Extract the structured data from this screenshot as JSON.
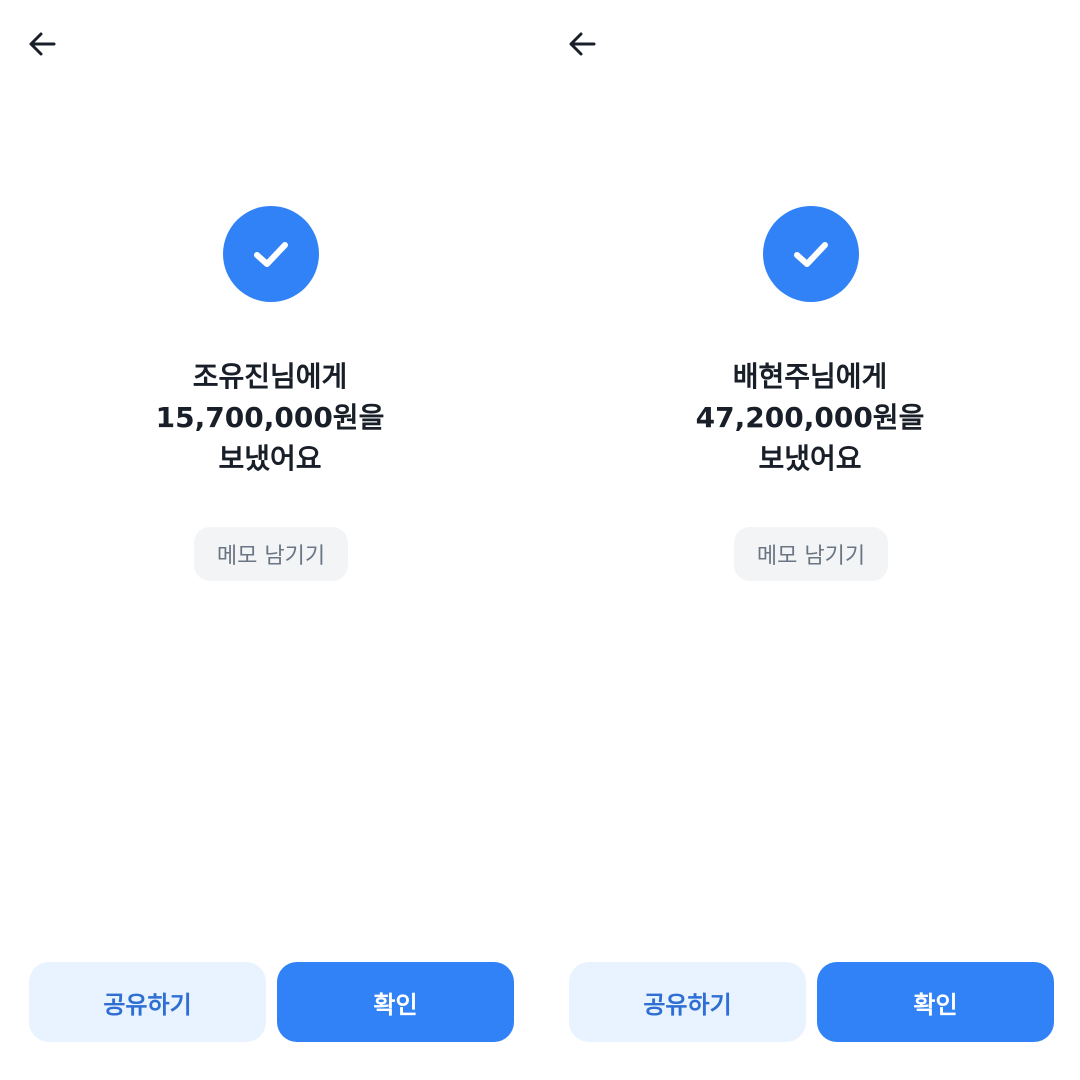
{
  "colors": {
    "primary": "#3182f6",
    "primary_light": "#e8f3ff",
    "text_dark": "#191f28",
    "text_gray": "#6b7684",
    "memo_bg": "#f2f4f6"
  },
  "icons": {
    "back": "arrow-left-icon",
    "success": "check-icon"
  },
  "screens": [
    {
      "message": {
        "line1": "조유진님에게",
        "line2": "15,700,000원을",
        "line3": "보냈어요"
      },
      "memo_label": "메모 남기기",
      "share_label": "공유하기",
      "confirm_label": "확인"
    },
    {
      "message": {
        "line1": "배현주님에게",
        "line2": "47,200,000원을",
        "line3": "보냈어요"
      },
      "memo_label": "메모 남기기",
      "share_label": "공유하기",
      "confirm_label": "확인"
    }
  ]
}
